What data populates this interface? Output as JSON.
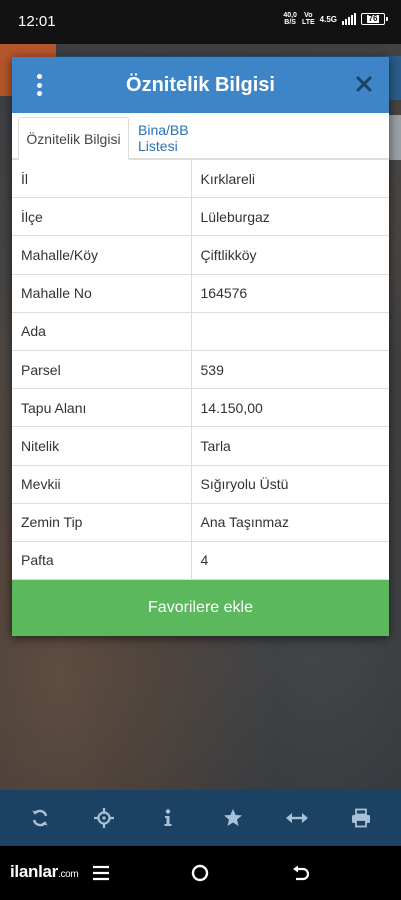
{
  "status_bar": {
    "time": "12:01",
    "net_speed_value": "40,0",
    "net_speed_unit": "B/S",
    "volte_top": "Vo",
    "volte_bottom": "LTE",
    "network_type": "4.5G",
    "battery": "76"
  },
  "dialog": {
    "title": "Öznitelik Bilgisi",
    "tabs": [
      {
        "label": "Öznitelik Bilgisi",
        "active": true
      },
      {
        "label": "Bina/BB Listesi",
        "active": false
      }
    ],
    "rows": [
      {
        "key": "İl",
        "value": "Kırklareli"
      },
      {
        "key": "İlçe",
        "value": "Lüleburgaz"
      },
      {
        "key": "Mahalle/Köy",
        "value": "Çiftlikköy"
      },
      {
        "key": "Mahalle No",
        "value": "164576"
      },
      {
        "key": "Ada",
        "value": ""
      },
      {
        "key": "Parsel",
        "value": "539"
      },
      {
        "key": "Tapu Alanı",
        "value": "14.150,00"
      },
      {
        "key": "Nitelik",
        "value": "Tarla"
      },
      {
        "key": "Mevkii",
        "value": "Sığıryolu Üstü"
      },
      {
        "key": "Zemin Tip",
        "value": "Ana Taşınmaz"
      },
      {
        "key": "Pafta",
        "value": "4"
      }
    ],
    "favorite_button": "Favorilere ekle"
  },
  "toolbar": {
    "icons": [
      "refresh-icon",
      "crosshair-icon",
      "info-icon",
      "star-icon",
      "measure-icon",
      "print-icon"
    ]
  },
  "navbar": {
    "brand_main": "ilanlar",
    "brand_suffix": ".com",
    "icons": [
      "menu-icon",
      "home-icon",
      "back-icon"
    ]
  },
  "colors": {
    "header_blue": "#3d85c6",
    "button_green": "#5cb85c",
    "toolbar_blue": "#1c4263",
    "tab_link": "#2a72b5"
  }
}
